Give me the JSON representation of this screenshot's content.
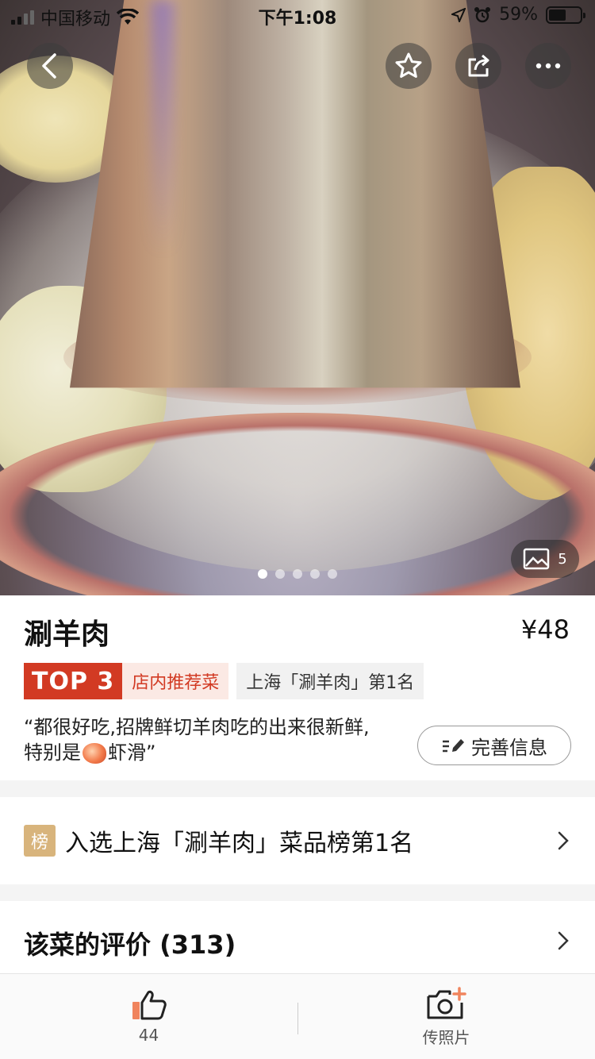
{
  "status_bar": {
    "carrier": "中国移动",
    "time": "下午1:08",
    "battery_percent": "59%",
    "battery_level": 0.59
  },
  "header": {
    "back_icon": "back-chevron-icon",
    "favorite_icon": "star-icon",
    "share_icon": "share-icon",
    "more_icon": "more-dots-icon"
  },
  "gallery": {
    "photo_count": "5",
    "dots_total": 5,
    "dots_active": 1
  },
  "dish": {
    "name": "涮羊肉",
    "price": "¥48",
    "top_label": "TOP 3",
    "recommend_label": "店内推荐菜",
    "rank_tag": "上海「涮羊肉」第1名",
    "quote_part1": "“都很好吃,招牌鲜切羊肉吃的出来很新鲜,特别是",
    "quote_part2": "虾滑”",
    "edit_button": "完善信息"
  },
  "ranking": {
    "badge": "榜",
    "text": "入选上海「涮羊肉」菜品榜第1名"
  },
  "reviews": {
    "title": "该菜的评价 (313)"
  },
  "bottom_bar": {
    "like_count": "44",
    "upload_label": "传照片"
  },
  "colors": {
    "accent_red": "#d23a23",
    "rank_gold": "#d8b47c"
  }
}
